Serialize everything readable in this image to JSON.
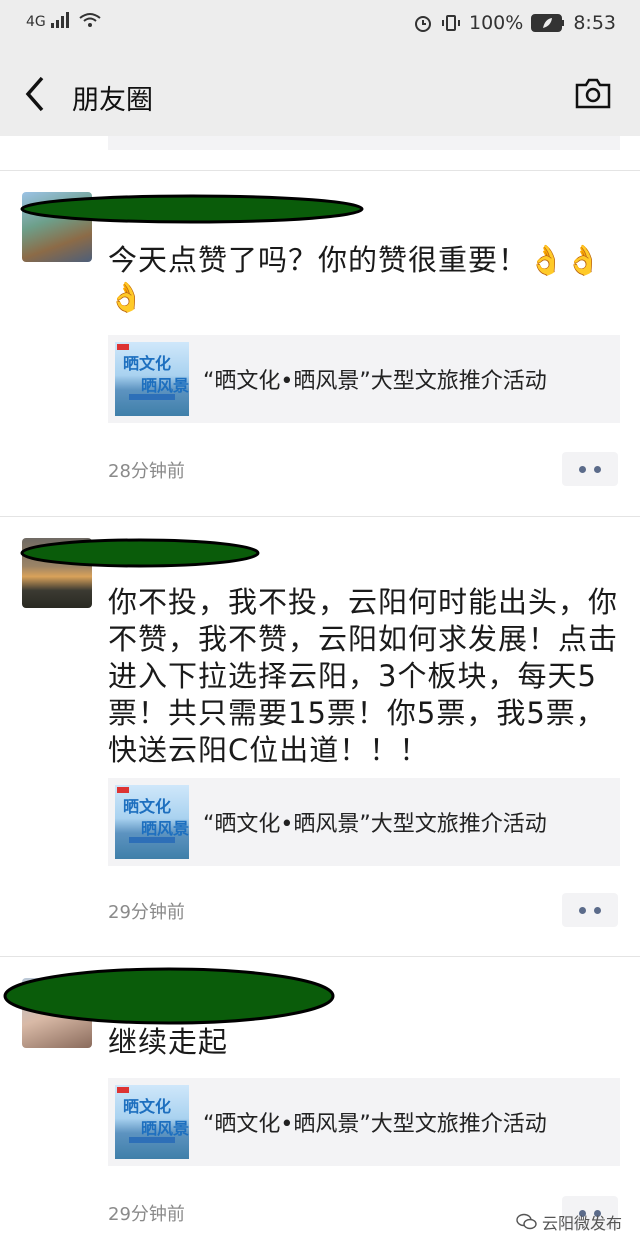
{
  "status_bar": {
    "network": "4G",
    "battery": "100%",
    "time": "8:53"
  },
  "nav": {
    "title": "朋友圈"
  },
  "posts": [
    {
      "text": "今天点赞了吗？你的赞很重要！👌👌👌",
      "link_title": "“晒文化•晒风景”大型文旅推介活动",
      "time": "28分钟前"
    },
    {
      "text": "你不投，我不投，云阳何时能出头，你不赞，我不赞，云阳如何求发展！点击进入下拉选择云阳，3个板块，每天5票！共只需要15票！你5票，我5票，快送云阳C位出道！！！",
      "link_title": "“晒文化•晒风景”大型文旅推介活动",
      "time": "29分钟前"
    },
    {
      "text": "继续走起",
      "link_title": "“晒文化•晒风景”大型文旅推介活动",
      "time": "29分钟前"
    }
  ],
  "thumb": {
    "line1": "晒文化",
    "line2": "晒风景"
  },
  "watermark": "云阳微发布",
  "colors": {
    "redaction": "#0a5c0a",
    "header_bg": "#ededed",
    "link_bg": "#f3f3f5",
    "dots": "#5b6b8a"
  }
}
